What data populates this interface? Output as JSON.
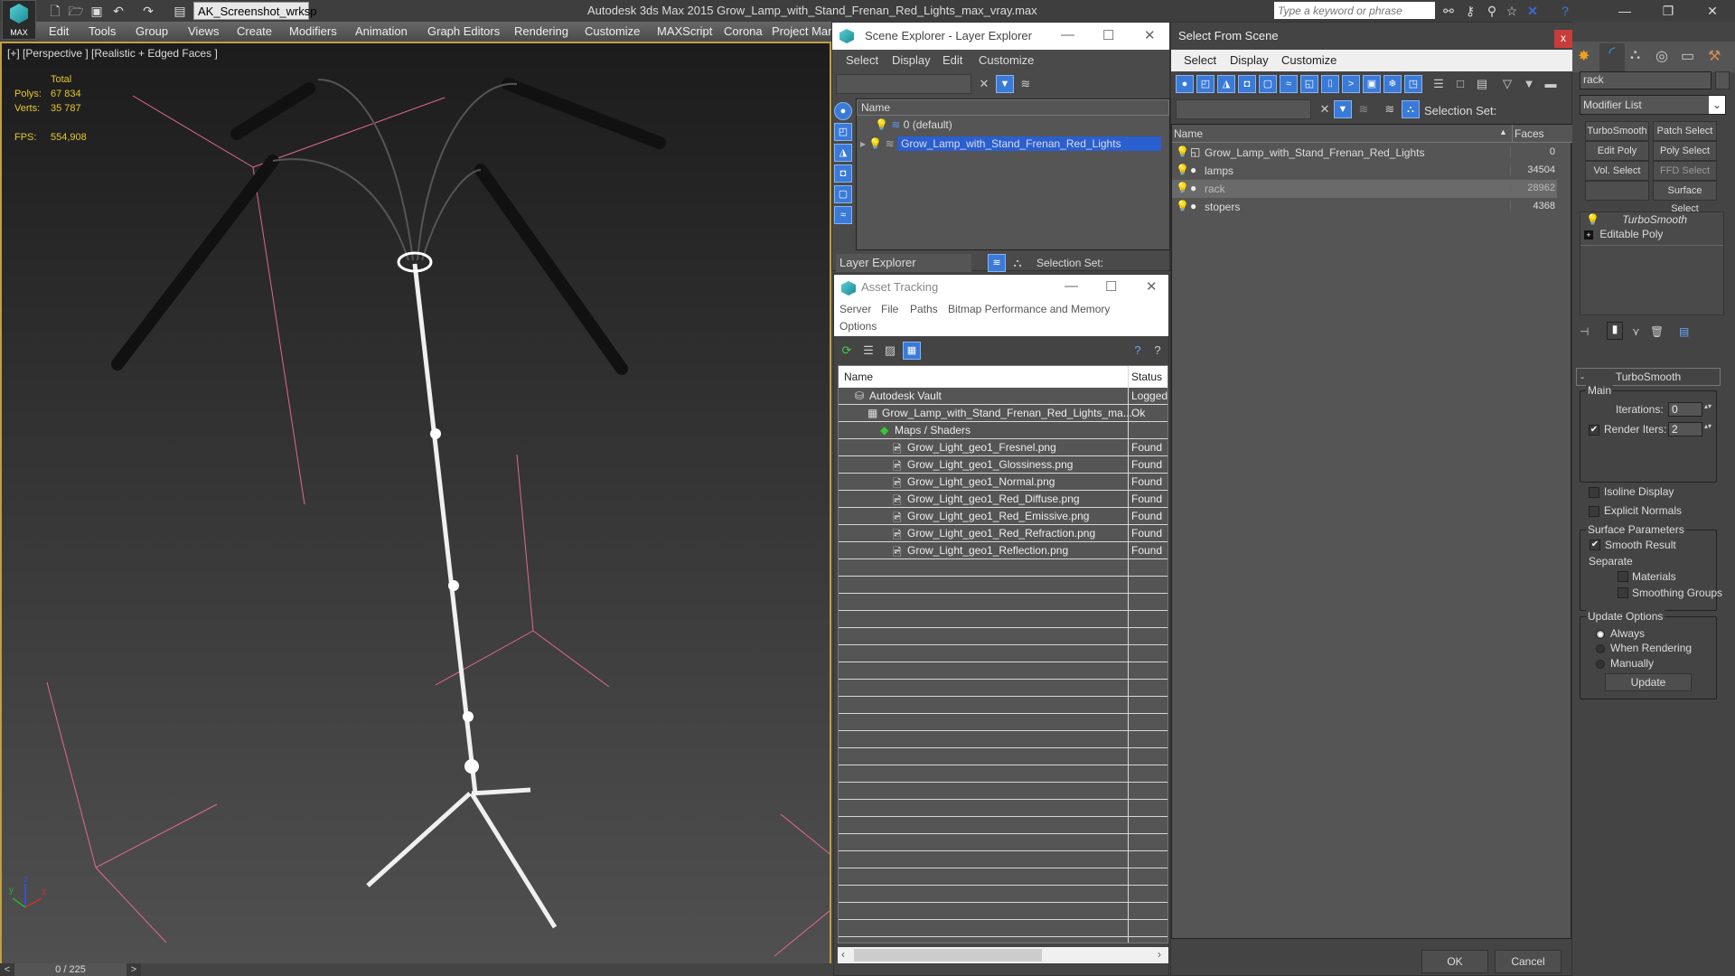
{
  "app": {
    "logo_label": "MAX",
    "workspace": "AK_Screenshot_wrksp",
    "title": "Autodesk 3ds Max  2015    Grow_Lamp_with_Stand_Frenan_Red_Lights_max_vray.max",
    "search_placeholder": "Type a keyword or phrase"
  },
  "menubar": [
    "Edit",
    "Tools",
    "Group",
    "Views",
    "Create",
    "Modifiers",
    "Animation",
    "Graph Editors",
    "Rendering",
    "Customize",
    "MAXScript",
    "Corona",
    "Project Mana"
  ],
  "viewport": {
    "label": "[+] [Perspective ] [Realistic + Edged Faces ]",
    "stats": {
      "total_label": "Total",
      "polys_label": "Polys:",
      "polys": "67 834",
      "verts_label": "Verts:",
      "verts": "35 787",
      "fps_label": "FPS:",
      "fps": "554,908"
    },
    "axis": {
      "x": "x",
      "y": "y",
      "z": "z"
    }
  },
  "timeline": {
    "frame": "0 / 225",
    "prev": "<",
    "next": ">"
  },
  "scene_explorer": {
    "title": "Scene Explorer - Layer Explorer",
    "menu": [
      "Select",
      "Display",
      "Edit",
      "Customize"
    ],
    "column": "Name",
    "layers": [
      {
        "name": "0 (default)",
        "selected": false
      },
      {
        "name": "Grow_Lamp_with_Stand_Frenan_Red_Lights",
        "selected": true
      }
    ],
    "footer_mode": "Layer Explorer",
    "selection_set_label": "Selection Set:"
  },
  "asset_tracking": {
    "title": "Asset Tracking",
    "menu": [
      "Server",
      "File",
      "Paths",
      "Bitmap Performance and Memory",
      "Options"
    ],
    "columns": [
      "Name",
      "Status"
    ],
    "rows": [
      {
        "name": "Autodesk Vault",
        "status": "Logged",
        "indent": 0
      },
      {
        "name": "Grow_Lamp_with_Stand_Frenan_Red_Lights_ma...",
        "status": "Ok",
        "indent": 1
      },
      {
        "name": "Maps / Shaders",
        "status": "",
        "indent": 2
      },
      {
        "name": "Grow_Light_geo1_Fresnel.png",
        "status": "Found",
        "indent": 3
      },
      {
        "name": "Grow_Light_geo1_Glossiness.png",
        "status": "Found",
        "indent": 3
      },
      {
        "name": "Grow_Light_geo1_Normal.png",
        "status": "Found",
        "indent": 3
      },
      {
        "name": "Grow_Light_geo1_Red_Diffuse.png",
        "status": "Found",
        "indent": 3
      },
      {
        "name": "Grow_Light_geo1_Red_Emissive.png",
        "status": "Found",
        "indent": 3
      },
      {
        "name": "Grow_Light_geo1_Red_Refraction.png",
        "status": "Found",
        "indent": 3
      },
      {
        "name": "Grow_Light_geo1_Reflection.png",
        "status": "Found",
        "indent": 3
      }
    ]
  },
  "select_from_scene": {
    "title": "Select From Scene",
    "close": "x",
    "menu": [
      "Select",
      "Display",
      "Customize"
    ],
    "selection_set_label": "Selection Set:",
    "columns": [
      "Name",
      "Faces"
    ],
    "rows": [
      {
        "name": "Grow_Lamp_with_Stand_Frenan_Red_Lights",
        "faces": "0",
        "selected": false
      },
      {
        "name": "lamps",
        "faces": "34504",
        "selected": false
      },
      {
        "name": "rack",
        "faces": "28962",
        "selected": true
      },
      {
        "name": "stopers",
        "faces": "4368",
        "selected": false
      }
    ],
    "ok": "OK",
    "cancel": "Cancel"
  },
  "command_panel": {
    "object_name": "rack",
    "modifier_list": "Modifier List",
    "modifier_buttons": [
      "TurboSmooth",
      "Patch Select",
      "Edit Poly",
      "Poly Select",
      "Vol. Select",
      "FFD Select",
      "",
      "Surface Select"
    ],
    "stack": [
      "TurboSmooth",
      "Editable Poly"
    ],
    "rollout": {
      "title": "TurboSmooth",
      "collapse": "-",
      "main_label": "Main",
      "iterations_label": "Iterations:",
      "iterations": "0",
      "render_iters_label": "Render Iters:",
      "render_iters": "2",
      "render_iters_checked": true,
      "isoline_label": "Isoline Display",
      "isoline_checked": false,
      "explicit_normals_label": "Explicit Normals",
      "explicit_normals_checked": false,
      "surface_label": "Surface Parameters",
      "smooth_result_label": "Smooth Result",
      "smooth_result_checked": true,
      "separate_label": "Separate",
      "materials_label": "Materials",
      "smoothing_groups_label": "Smoothing Groups",
      "update_label": "Update Options",
      "options": [
        "Always",
        "When Rendering",
        "Manually"
      ],
      "selected_option": "Always",
      "update_button": "Update"
    }
  },
  "colors": {
    "accent_blue": "#3a7ad8",
    "selection": "#2a5fd0",
    "viewport_border": "#c0a040",
    "stats": "#e6c830"
  }
}
